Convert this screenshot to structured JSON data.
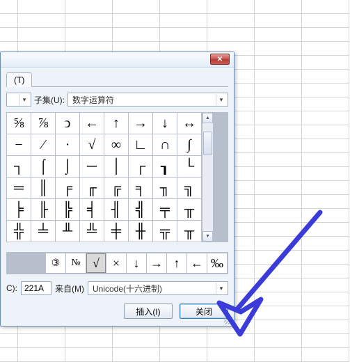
{
  "tab": {
    "label": "(T)"
  },
  "subset": {
    "label": "子集(U):",
    "value": "数字运算符"
  },
  "combo_left_value": "",
  "symbols_grid": [
    [
      "⅝",
      "⅞",
      "ↄ",
      "←",
      "↑",
      "→",
      "↓",
      "↔"
    ],
    [
      "−",
      "∕",
      "∙",
      "√",
      "∞",
      "∟",
      "∩",
      "∫"
    ],
    [
      "┐",
      "⌠",
      "⌡",
      "─",
      "│",
      "┌",
      "┒",
      "└"
    ],
    [
      "═",
      "║",
      "╒",
      "╓",
      "╔",
      "╕",
      "╖",
      "╗"
    ],
    [
      "╞",
      "╟",
      "╠",
      "╡",
      "╢",
      "╣",
      "╤",
      "╥"
    ],
    [
      "╬",
      "╧",
      "╨",
      "╩",
      "╪",
      "╫",
      "╦",
      "╥"
    ]
  ],
  "recent": [
    "③",
    "№",
    "√",
    "×",
    "↓",
    "→",
    "↑",
    "←",
    "‰"
  ],
  "selected_recent": "√",
  "code": {
    "label": "C):",
    "value": "221A"
  },
  "from": {
    "label": "来自(M)",
    "value": "Unicode(十六进制)"
  },
  "buttons": {
    "insert": "插入(I)",
    "close": "关闭"
  },
  "colors": {
    "arrow": "#3b3bd8"
  }
}
